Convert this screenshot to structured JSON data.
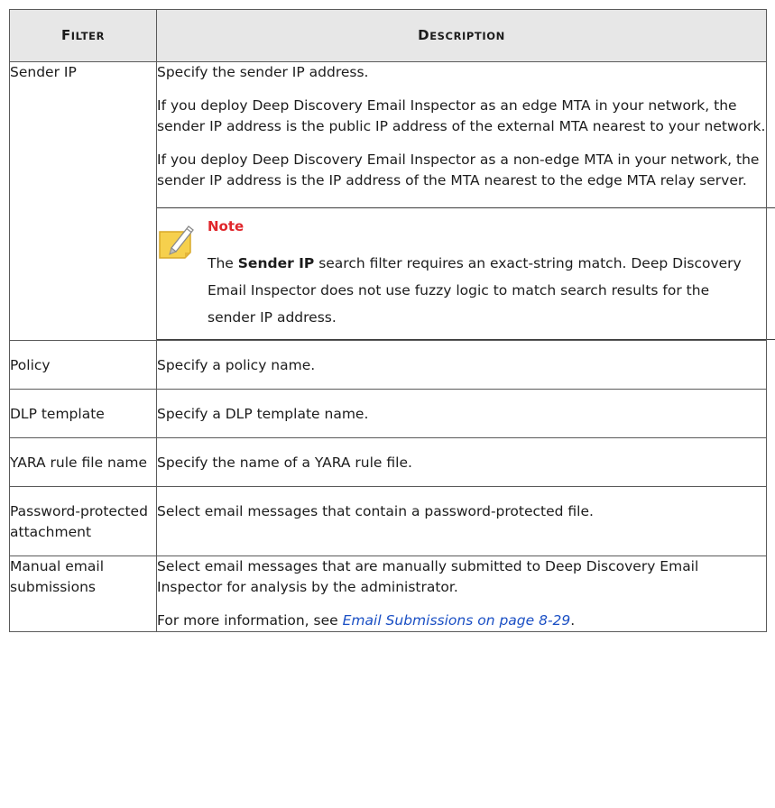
{
  "table": {
    "header": {
      "filter": {
        "first": "F",
        "rest": "ILTER"
      },
      "description": {
        "first": "D",
        "rest": "ESCRIPTION"
      }
    },
    "rows": [
      {
        "filter": "Sender IP",
        "desc_p1": "Specify the sender IP address.",
        "desc_p2": "If you deploy Deep Discovery Email Inspector as an edge MTA in your network, the sender IP address is the public IP address of the external MTA nearest to your network.",
        "desc_p3": "If you deploy Deep Discovery Email Inspector as a non-edge MTA in your network, the sender IP address is the IP address of the MTA nearest to the edge MTA relay server.",
        "note": {
          "title": "Note",
          "text_before": "The ",
          "bold": "Sender IP",
          "text_after": " search filter requires an exact-string match. Deep Discovery Email Inspector does not use fuzzy logic to match search results for the sender IP address."
        }
      },
      {
        "filter": "Policy",
        "desc": "Specify a policy name."
      },
      {
        "filter": "DLP template",
        "desc": "Specify a DLP template name."
      },
      {
        "filter": "YARA rule file name",
        "desc": "Specify the name of a YARA rule file."
      },
      {
        "filter": "Password-protected attachment",
        "desc": "Select email messages that contain a password-protected file."
      },
      {
        "filter": "Manual email submissions",
        "desc_p1": "Select email messages that are manually submitted to Deep Discovery Email Inspector for analysis by the administrator.",
        "desc_p2_before": "For more information, see ",
        "desc_p2_link": "Email Submissions on page 8-29",
        "desc_p2_after": "."
      }
    ]
  },
  "colors": {
    "header_bg": "#e7e7e7",
    "note_title": "#e0262b",
    "link": "#1a4fc4",
    "note_icon": "#f6d04d"
  }
}
